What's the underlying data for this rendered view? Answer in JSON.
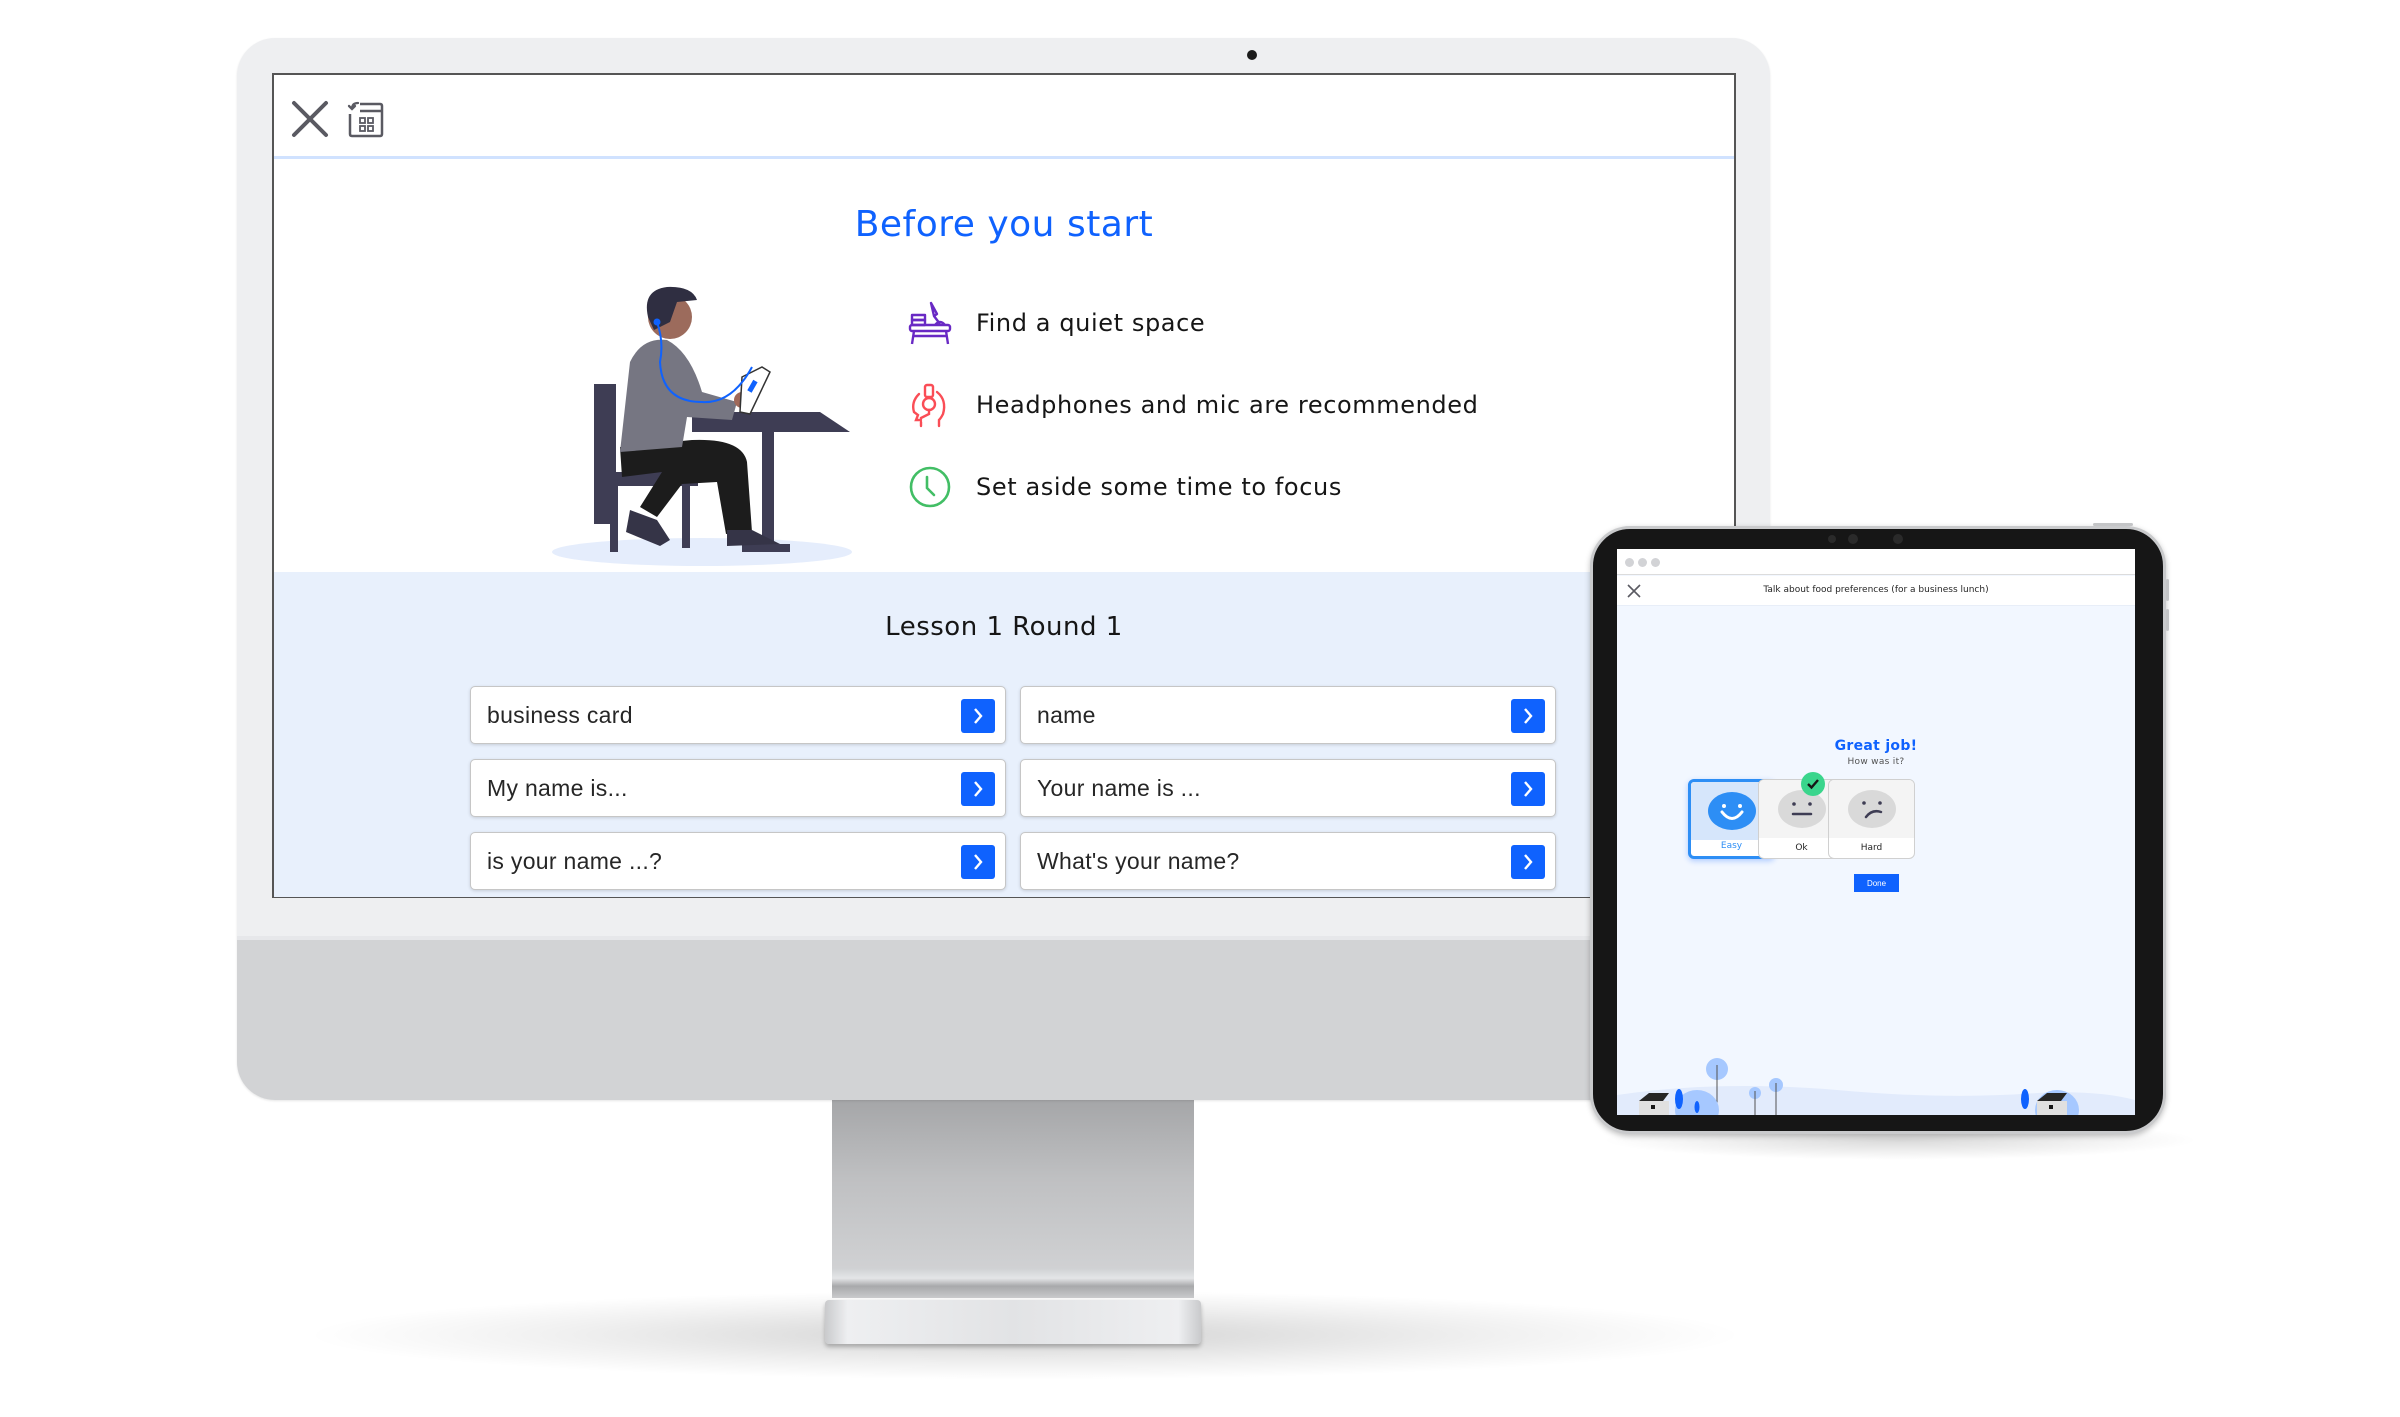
{
  "desktop": {
    "topbar": {
      "close_icon": "close-icon",
      "apps_icon": "back-to-apps-grid-icon"
    },
    "intro": {
      "title": "Before you start",
      "illustration": "person-at-table-with-phone-and-earphones",
      "checklist": [
        {
          "icon": "desk-lamp-icon",
          "text": "Find a quiet space",
          "color": "#6929c4"
        },
        {
          "icon": "headset-mic-icon",
          "text": "Headphones and mic are recommended",
          "color": "#fa4d56"
        },
        {
          "icon": "clock-icon",
          "text": "Set aside some time to focus",
          "color": "#42be65"
        }
      ]
    },
    "lesson": {
      "title": "Lesson 1 Round 1",
      "cards": [
        {
          "text": "business card"
        },
        {
          "text": "name"
        },
        {
          "text": "My name is..."
        },
        {
          "text": "Your name is ..."
        },
        {
          "text": "is your name ...?"
        },
        {
          "text": "What's your name?"
        }
      ]
    }
  },
  "tablet": {
    "header_title": "Talk about food preferences (for a business lunch)",
    "heading": "Great job!",
    "subheading": "How was it?",
    "ratings": [
      {
        "label": "Easy",
        "face": "happy-face-icon",
        "selected": true
      },
      {
        "label": "Ok",
        "face": "neutral-face-icon",
        "selected": false
      },
      {
        "label": "Hard",
        "face": "confused-face-icon",
        "selected": false
      }
    ],
    "done_label": "Done"
  },
  "colors": {
    "accent": "#0f62fe",
    "lesson_bg": "#e8f0fc",
    "success": "#3ad58c",
    "selected_rating": "#2d8ef5"
  }
}
